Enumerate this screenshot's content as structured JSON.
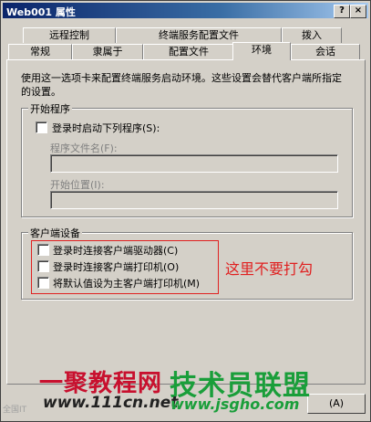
{
  "window": {
    "title": "Web001 属性",
    "help_btn": "?",
    "close_btn": "×"
  },
  "tabs_back": [
    {
      "label": "远程控制"
    },
    {
      "label": "终端服务配置文件"
    },
    {
      "label": "拨入"
    }
  ],
  "tabs_front": [
    {
      "label": "常规"
    },
    {
      "label": "隶属于"
    },
    {
      "label": "配置文件"
    },
    {
      "label": "环境"
    },
    {
      "label": "会话"
    }
  ],
  "active_tab": "环境",
  "description": "使用这一选项卡来配置终端服务启动环境。这些设置会替代客户端所指定的设置。",
  "startup": {
    "group_title": "开始程序",
    "launch_checkbox_label": "登录时启动下列程序(S):",
    "launch_checked": false,
    "program_label": "程序文件名(F):",
    "program_value": "",
    "start_dir_label": "开始位置(I):",
    "start_dir_value": ""
  },
  "client_devices": {
    "group_title": "客户端设备",
    "items": [
      {
        "label": "登录时连接客户端驱动器(C)",
        "checked": false
      },
      {
        "label": "登录时连接客户端打印机(O)",
        "checked": false
      },
      {
        "label": "将默认值设为主客户端打印机(M)",
        "checked": false
      }
    ]
  },
  "annotation": "这里不要打勾",
  "buttons": {
    "apply": "(A)"
  },
  "watermark": {
    "left_title": "一聚教程网",
    "right_title": "技术员联盟",
    "left_url": "www.111cn.net",
    "right_url": "www.jsgho.com",
    "grey_text": "全国IT"
  },
  "colors": {
    "title_bar": "#0a246a",
    "annotation": "#e02020",
    "watermark_red": "#c8102e",
    "watermark_green": "#1a9e3a"
  }
}
